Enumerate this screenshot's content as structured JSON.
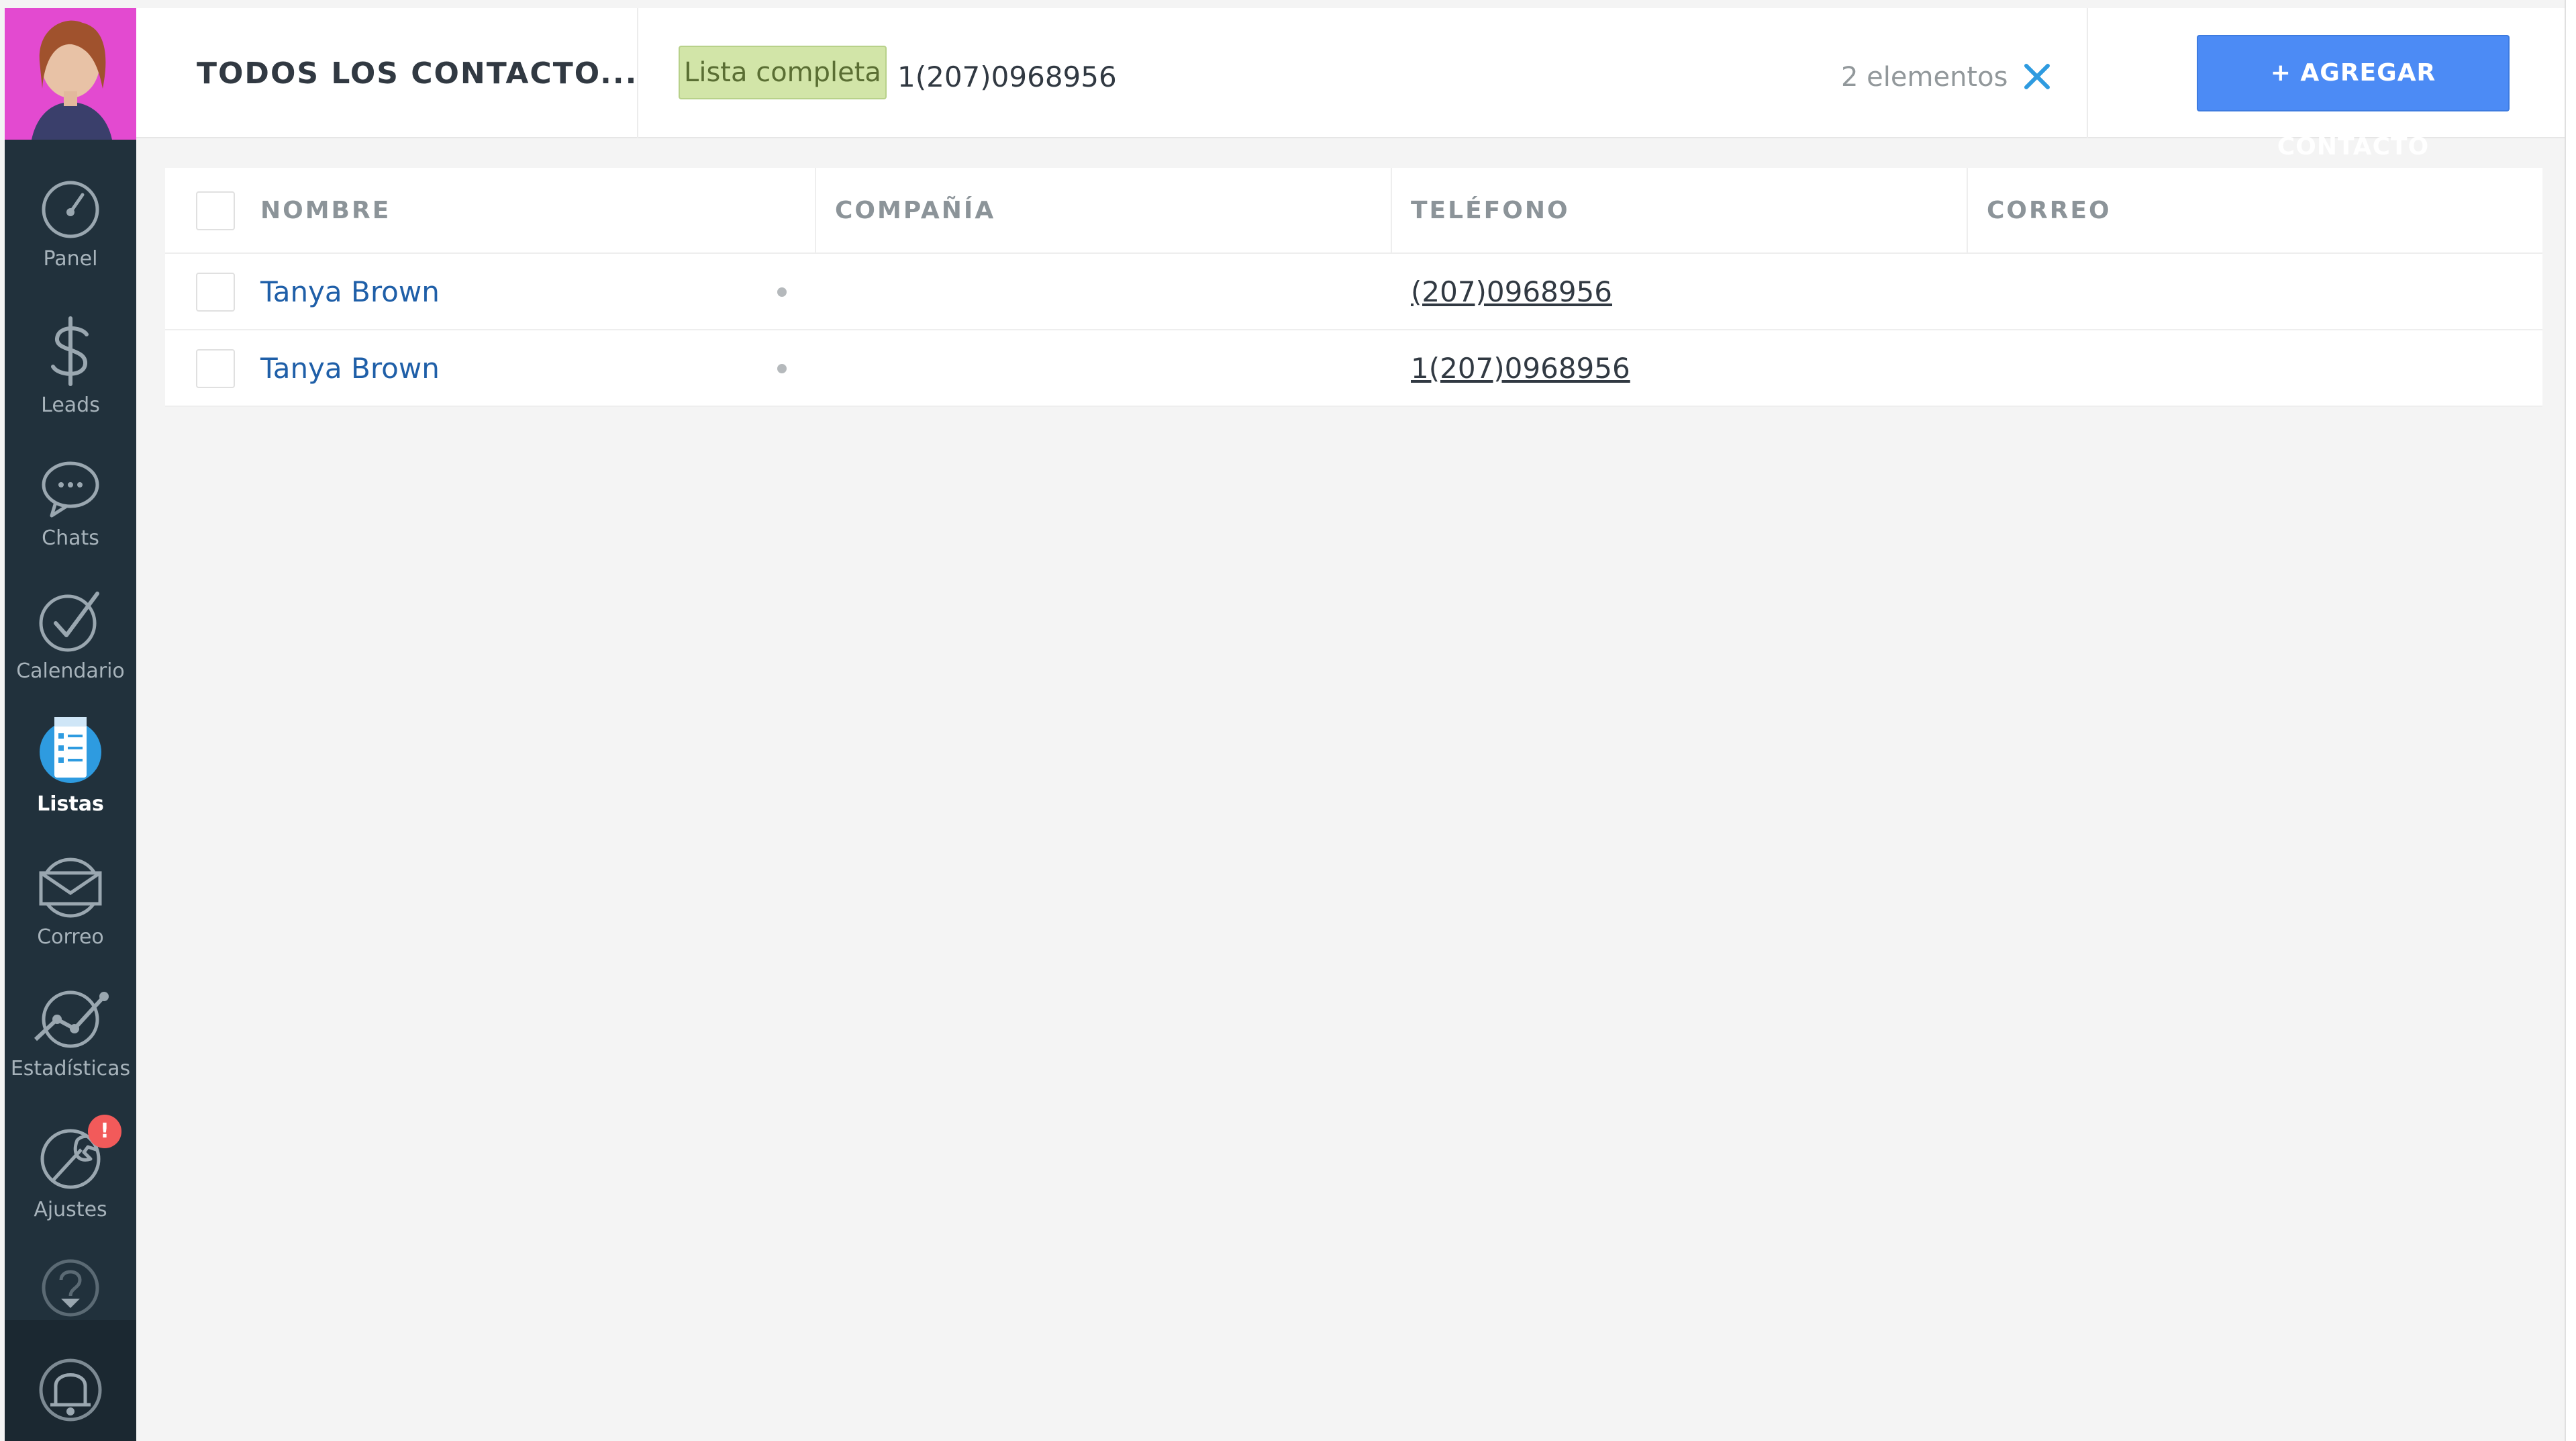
{
  "sidebar": {
    "items": [
      {
        "id": "panel",
        "label": "Panel",
        "icon": "dashboard-gauge-icon"
      },
      {
        "id": "leads",
        "label": "Leads",
        "icon": "dollar-icon"
      },
      {
        "id": "chats",
        "label": "Chats",
        "icon": "chat-bubble-icon"
      },
      {
        "id": "calendario",
        "label": "Calendario",
        "icon": "checkmark-circle-icon"
      },
      {
        "id": "listas",
        "label": "Listas",
        "icon": "list-icon"
      },
      {
        "id": "correo",
        "label": "Correo",
        "icon": "envelope-icon"
      },
      {
        "id": "estadisticas",
        "label": "Estadísticas",
        "icon": "stats-graph-icon"
      },
      {
        "id": "ajustes",
        "label": "Ajustes",
        "icon": "wrench-icon"
      }
    ],
    "active": "Listas",
    "ajustes_badge": "!"
  },
  "header": {
    "title": "TODOS LOS CONTACTO...",
    "filter_chip": "Lista completa",
    "search_value": "1(207)0968956",
    "count": "2 elementos",
    "more": "···",
    "add_button": "+ AGREGAR CONTACTO"
  },
  "table": {
    "columns": [
      "NOMBRE",
      "COMPAÑÍA",
      "TELÉFONO",
      "CORREO"
    ],
    "rows": [
      {
        "name": "Tanya Brown",
        "company": "",
        "phone": "(207)0968956",
        "email": ""
      },
      {
        "name": "Tanya Brown",
        "company": "",
        "phone": "1(207)0968956",
        "email": ""
      }
    ]
  },
  "colors": {
    "sidebar_bg": "#21313c",
    "accent_blue": "#4c8bf5",
    "chip_green": "#d2e5a8",
    "link_blue": "#1f5fa8",
    "badge_red": "#f25a5a"
  }
}
